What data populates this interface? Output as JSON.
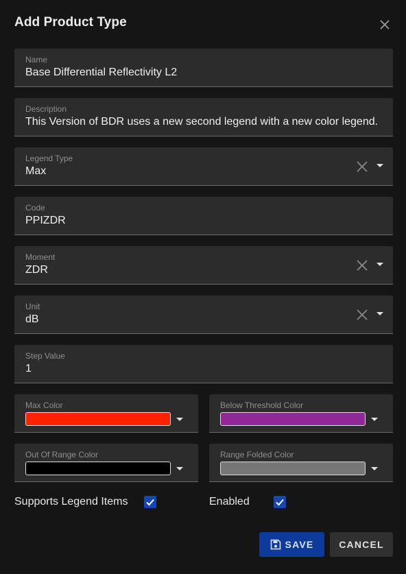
{
  "dialog": {
    "title": "Add Product Type"
  },
  "fields": {
    "name": {
      "label": "Name",
      "value": "Base Differential Reflectivity L2"
    },
    "description": {
      "label": "Description",
      "value": "This Version of BDR uses a new second legend with a new color legend."
    },
    "legend_type": {
      "label": "Legend Type",
      "value": "Max"
    },
    "code": {
      "label": "Code",
      "value": "PPIZDR"
    },
    "moment": {
      "label": "Moment",
      "value": "ZDR"
    },
    "unit": {
      "label": "Unit",
      "value": "dB"
    },
    "step_value": {
      "label": "Step Value",
      "value": "1"
    }
  },
  "colors": {
    "max": {
      "label": "Max Color",
      "color": "#ff2200"
    },
    "below_threshold": {
      "label": "Below Threshold Color",
      "color": "#922796"
    },
    "out_of_range": {
      "label": "Out Of Range Color",
      "color": "#000000"
    },
    "range_folded": {
      "label": "Range Folded Color",
      "color": "#777777"
    }
  },
  "checkboxes": {
    "supports_legend_items": {
      "label": "Supports Legend Items",
      "checked": true
    },
    "enabled": {
      "label": "Enabled",
      "checked": true
    }
  },
  "actions": {
    "save_label": "SAVE",
    "cancel_label": "CANCEL"
  },
  "icons": {
    "close": "close-icon",
    "clear": "clear-icon",
    "dropdown": "chevron-down-icon",
    "save": "floppy-disk-icon",
    "check": "checkmark-icon"
  },
  "theme": {
    "accent": "#1646b4",
    "save_button": "#0e3a9c",
    "field_bg": "#2c2c2c",
    "page_bg": "#151515"
  }
}
